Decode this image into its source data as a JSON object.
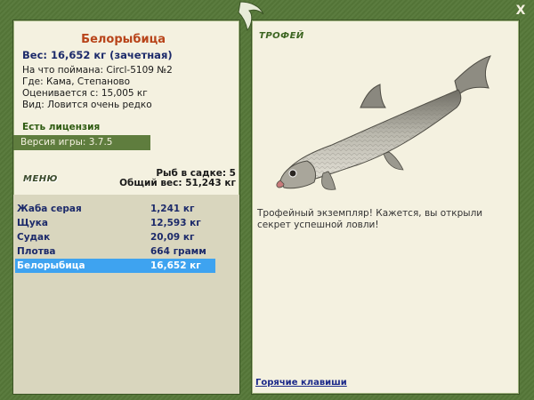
{
  "fish": {
    "name": "Белорыбица",
    "weight_line": "Вес: 16,652 кг (зачетная)",
    "caught_with": "На что поймана: Circl-5109 №2",
    "location": "Где: Кама, Степаново",
    "value": "Оценивается с: 15,005 кг",
    "species_note": "Вид: Ловится очень редко"
  },
  "license": {
    "label": "Есть лицензия"
  },
  "version": {
    "label": "Версия игры: 3.7.5"
  },
  "menu": {
    "label": "МЕНЮ"
  },
  "cage": {
    "count": "Рыб в садке: 5",
    "total": "Общий вес: 51,243 кг"
  },
  "catch_list": [
    {
      "name": "Жаба серая",
      "weight": "1,241 кг"
    },
    {
      "name": "Щука",
      "weight": "12,593 кг"
    },
    {
      "name": "Судак",
      "weight": "20,09 кг"
    },
    {
      "name": "Плотва",
      "weight": "664 грамм"
    },
    {
      "name": "Белорыбица",
      "weight": "16,652 кг",
      "selected": true
    }
  ],
  "trophy": {
    "title": "ТРОФЕЙ",
    "text": "Трофейный экземпляр! Кажется, вы открыли секрет успешной ловли!"
  },
  "footer": {
    "hotkeys": "Горячие клавиши"
  },
  "close": {
    "label": "X"
  },
  "colors": {
    "frame": "#567839",
    "panel": "#f4f1e0",
    "selected_row": "#3ea3f0",
    "fish_name": "#b8441a"
  }
}
